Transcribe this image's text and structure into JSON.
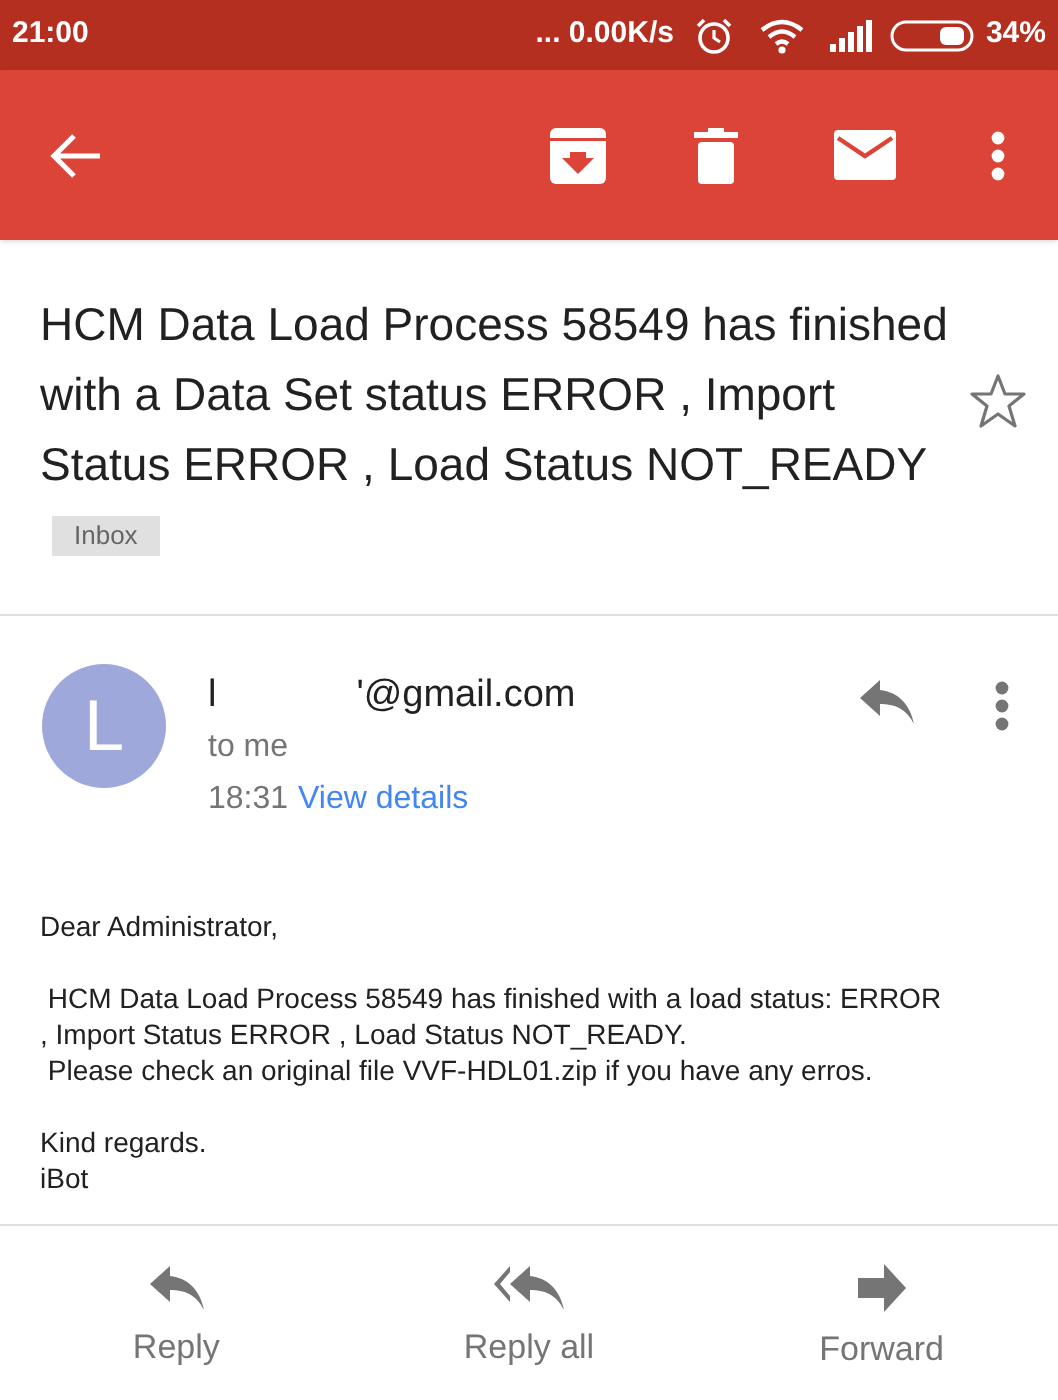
{
  "status_bar": {
    "time": "21:00",
    "network_speed": "... 0.00K/s",
    "battery": "34%"
  },
  "subject": {
    "title": "HCM Data Load Process 58549 has finished with a Data Set status ERROR , Import Status ERROR , Load Status NOT_READY",
    "label": "Inbox",
    "starred": false
  },
  "message": {
    "avatar_letter": "L",
    "sender_start": "l",
    "sender_end": "'@gmail.com",
    "recipient": "to me",
    "time": "18:31",
    "details_link": "View details",
    "body": [
      {
        "kind": "line",
        "text": "Dear Administrator,"
      },
      {
        "kind": "gap"
      },
      {
        "kind": "line",
        "text": " HCM Data Load Process 58549 has finished with a load status: ERROR"
      },
      {
        "kind": "line",
        "text": ", Import Status ERROR , Load Status NOT_READY."
      },
      {
        "kind": "line",
        "text": " Please check an original file VVF-HDL01.zip if you have any erros."
      },
      {
        "kind": "gap"
      },
      {
        "kind": "line",
        "text": "Kind regards."
      },
      {
        "kind": "line",
        "text": "iBot"
      }
    ]
  },
  "actions": [
    {
      "kind": "reply",
      "label": "Reply"
    },
    {
      "kind": "reply_all",
      "label": "Reply all"
    },
    {
      "kind": "forward",
      "label": "Forward"
    }
  ]
}
